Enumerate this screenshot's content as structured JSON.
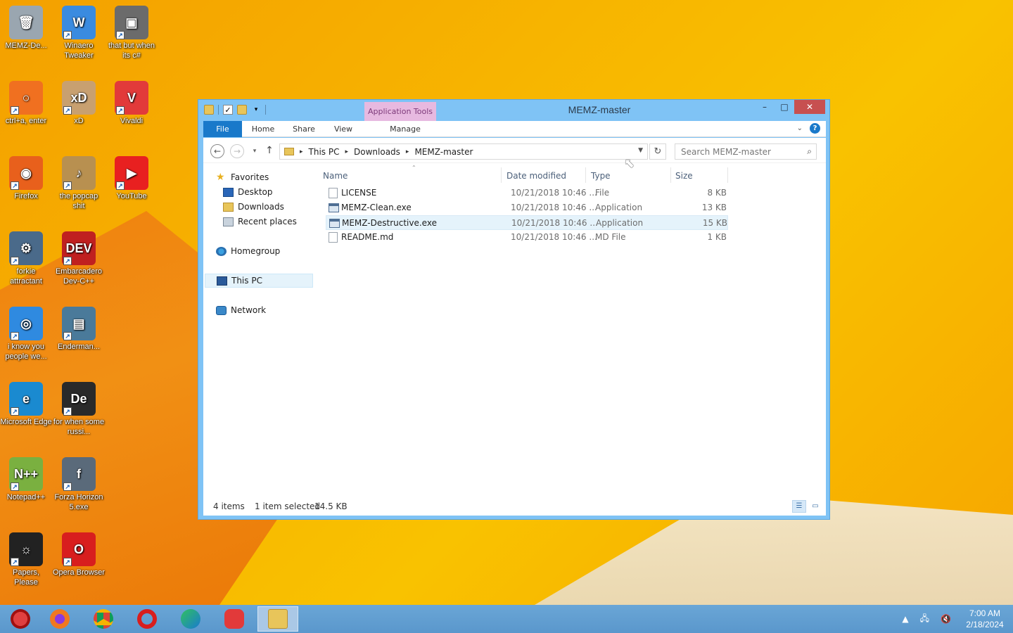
{
  "desktop": {
    "icons": [
      {
        "label": "MEMZ-De...",
        "color": "#9aa6b0",
        "glyph": "🗑"
      },
      {
        "label": "Winaero Tweaker",
        "color": "#3a8be0",
        "glyph": "W"
      },
      {
        "label": "that but when its c#",
        "color": "#6b6b6b",
        "glyph": "▣"
      },
      {
        "label": "ctrl+a, enter",
        "color": "#f07020",
        "glyph": "○"
      },
      {
        "label": "xD",
        "color": "#c8a070",
        "glyph": "xD"
      },
      {
        "label": "Vivaldi",
        "color": "#e23a3a",
        "glyph": "V"
      },
      {
        "label": "Firefox",
        "color": "#e8601c",
        "glyph": "◉"
      },
      {
        "label": "the popcap shit",
        "color": "#b89050",
        "glyph": "♪"
      },
      {
        "label": "YouTube",
        "color": "#e82020",
        "glyph": "▶"
      },
      {
        "label": "forkie attractant",
        "color": "#4a6a8a",
        "glyph": "⚙"
      },
      {
        "label": "Embarcadero Dev-C++",
        "color": "#c02020",
        "glyph": "DEV"
      },
      {
        "label": "i know you people we...",
        "color": "#2f8ae0",
        "glyph": "◎"
      },
      {
        "label": "Enderman...",
        "color": "#4a7a9a",
        "glyph": "▤"
      },
      {
        "label": "Microsoft Edge",
        "color": "#1a8ad0",
        "glyph": "e"
      },
      {
        "label": "for when some russi...",
        "color": "#2a2a2a",
        "glyph": "De"
      },
      {
        "label": "Notepad++",
        "color": "#7ab040",
        "glyph": "N++"
      },
      {
        "label": "Forza Horizon 5.exe",
        "color": "#5a6a7a",
        "glyph": "f"
      },
      {
        "label": "Papers, Please",
        "color": "#222222",
        "glyph": "☼"
      },
      {
        "label": "Opera Browser",
        "color": "#d81e1e",
        "glyph": "O"
      }
    ]
  },
  "window": {
    "title": "MEMZ-master",
    "context_tab": "Application Tools",
    "ribbon_tabs": {
      "file": "File",
      "home": "Home",
      "share": "Share",
      "view": "View",
      "manage": "Manage"
    },
    "address": {
      "crumbs": [
        "This PC",
        "Downloads",
        "MEMZ-master"
      ]
    },
    "search_placeholder": "Search MEMZ-master",
    "nav_pane": {
      "favorites": "Favorites",
      "desktop": "Desktop",
      "downloads": "Downloads",
      "recent": "Recent places",
      "homegroup": "Homegroup",
      "this_pc": "This PC",
      "network": "Network"
    },
    "columns": {
      "name": "Name",
      "date": "Date modified",
      "type": "Type",
      "size": "Size"
    },
    "files": [
      {
        "name": "LICENSE",
        "date": "10/21/2018 10:46 ...",
        "type": "File",
        "size": "8 KB",
        "kind": "doc"
      },
      {
        "name": "MEMZ-Clean.exe",
        "date": "10/21/2018 10:46 ...",
        "type": "Application",
        "size": "13 KB",
        "kind": "app"
      },
      {
        "name": "MEMZ-Destructive.exe",
        "date": "10/21/2018 10:46 ...",
        "type": "Application",
        "size": "15 KB",
        "kind": "app",
        "selected": true
      },
      {
        "name": "README.md",
        "date": "10/21/2018 10:46 ...",
        "type": "MD File",
        "size": "1 KB",
        "kind": "doc"
      }
    ],
    "status": {
      "count": "4 items",
      "selected": "1 item selected",
      "size": "14.5 KB"
    }
  },
  "taskbar": {
    "clock_time": "7:00 AM",
    "clock_date": "2/18/2024"
  }
}
